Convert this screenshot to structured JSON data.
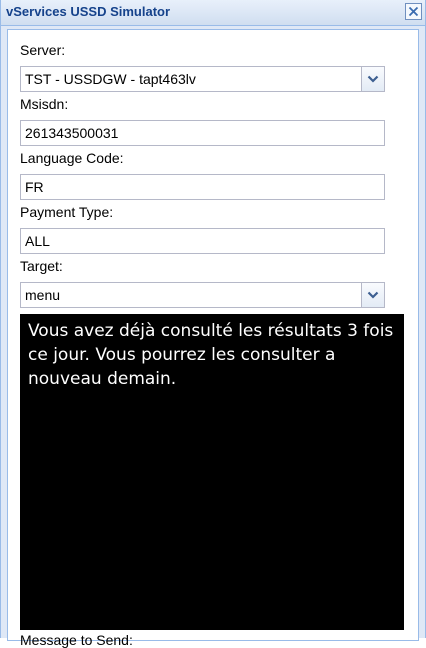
{
  "window": {
    "title": "vServices USSD Simulator"
  },
  "form": {
    "server": {
      "label": "Server:",
      "value": "TST - USSDGW - tapt463lv"
    },
    "msisdn": {
      "label": "Msisdn:",
      "value": "261343500031"
    },
    "language": {
      "label": "Language Code:",
      "value": "FR"
    },
    "payment": {
      "label": "Payment Type:",
      "value": "ALL"
    },
    "target": {
      "label": "Target:",
      "value": "menu"
    }
  },
  "screen": {
    "message": "Vous avez déjà consulté les résultats 3 fois ce jour. Vous pourrez les consulter a nouveau demain."
  },
  "footer": {
    "label": "Message to Send:"
  },
  "icons": {
    "close": "close-icon",
    "dropdown": "chevron-down-icon"
  },
  "colors": {
    "header_text": "#15428b",
    "frame": "#99bbe8",
    "screen_bg": "#000000",
    "screen_text": "#ffffff"
  }
}
